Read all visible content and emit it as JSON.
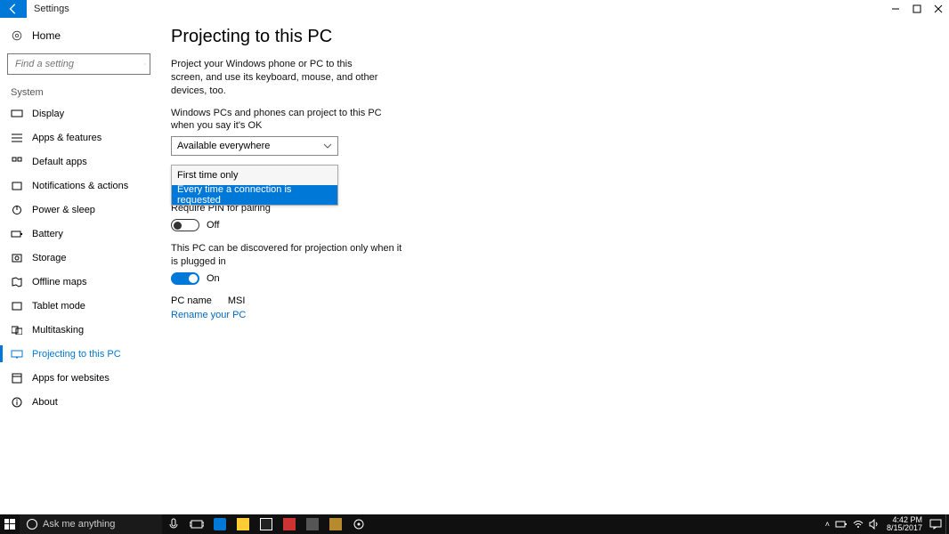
{
  "app_title": "Settings",
  "sidebar": {
    "home": "Home",
    "search_placeholder": "Find a setting",
    "section": "System",
    "items": [
      {
        "label": "Display"
      },
      {
        "label": "Apps & features"
      },
      {
        "label": "Default apps"
      },
      {
        "label": "Notifications & actions"
      },
      {
        "label": "Power & sleep"
      },
      {
        "label": "Battery"
      },
      {
        "label": "Storage"
      },
      {
        "label": "Offline maps"
      },
      {
        "label": "Tablet mode"
      },
      {
        "label": "Multitasking"
      },
      {
        "label": "Projecting to this PC"
      },
      {
        "label": "Apps for websites"
      },
      {
        "label": "About"
      }
    ]
  },
  "main": {
    "heading": "Projecting to this PC",
    "description": "Project your Windows phone or PC to this screen, and use its keyboard, mouse, and other devices, too.",
    "combo1_label": "Windows PCs and phones can project to this PC when you say it's OK",
    "combo1_value": "Available everywhere",
    "dropdown_opts": [
      {
        "label": "First time only"
      },
      {
        "label": "Every time a connection is requested"
      }
    ],
    "pin_label": "Require PIN for pairing",
    "pin_value": "Off",
    "discover_label": "This PC can be discovered for projection only when it is plugged in",
    "discover_value": "On",
    "pcname_label": "PC name",
    "pcname_value": "MSI",
    "rename_link": "Rename your PC"
  },
  "taskbar": {
    "search_placeholder": "Ask me anything",
    "clock_time": "4:42 PM",
    "clock_date": "8/15/2017"
  }
}
